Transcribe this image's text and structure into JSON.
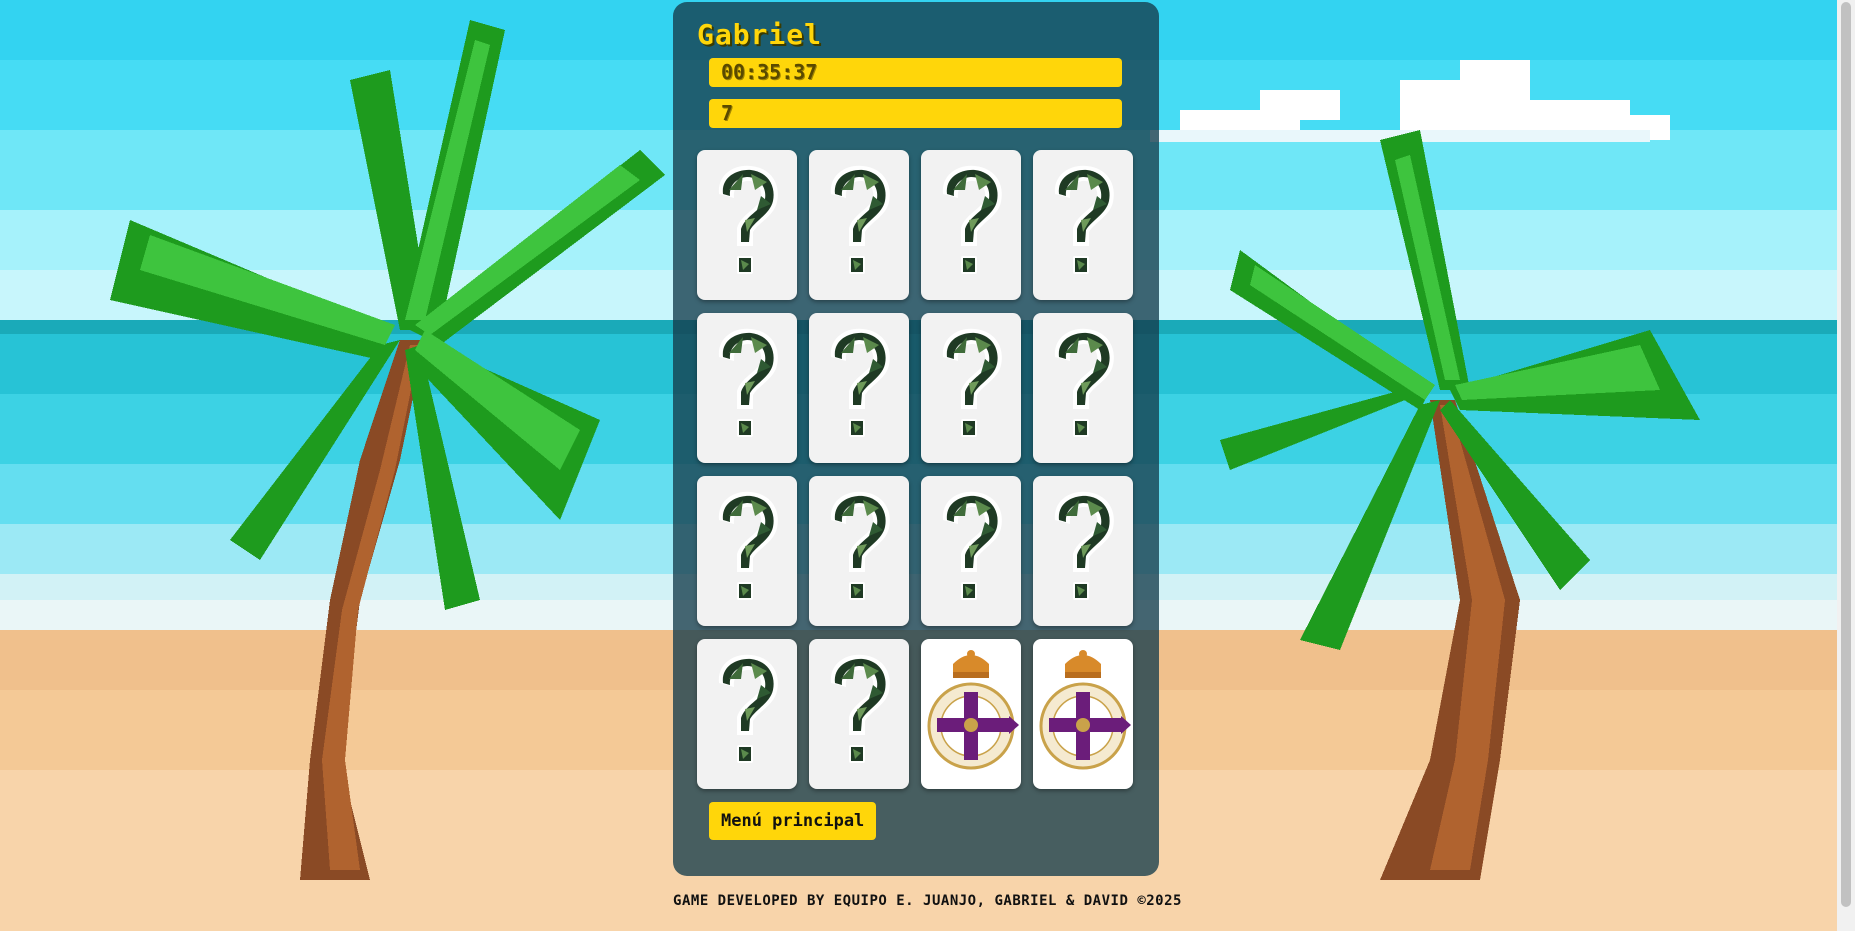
{
  "player": {
    "name": "Gabriel"
  },
  "stats": {
    "timer": "00:35:37",
    "moves": "7"
  },
  "board": {
    "cards": [
      {
        "state": "hidden",
        "icon": "question-mark-leaf-icon"
      },
      {
        "state": "hidden",
        "icon": "question-mark-leaf-icon"
      },
      {
        "state": "hidden",
        "icon": "question-mark-leaf-icon"
      },
      {
        "state": "hidden",
        "icon": "question-mark-leaf-icon"
      },
      {
        "state": "hidden",
        "icon": "question-mark-leaf-icon"
      },
      {
        "state": "hidden",
        "icon": "question-mark-leaf-icon"
      },
      {
        "state": "hidden",
        "icon": "question-mark-leaf-icon"
      },
      {
        "state": "hidden",
        "icon": "question-mark-leaf-icon"
      },
      {
        "state": "hidden",
        "icon": "question-mark-leaf-icon"
      },
      {
        "state": "hidden",
        "icon": "question-mark-leaf-icon"
      },
      {
        "state": "hidden",
        "icon": "question-mark-leaf-icon"
      },
      {
        "state": "hidden",
        "icon": "question-mark-leaf-icon"
      },
      {
        "state": "hidden",
        "icon": "question-mark-leaf-icon"
      },
      {
        "state": "hidden",
        "icon": "question-mark-leaf-icon"
      },
      {
        "state": "revealed",
        "icon": "deportivo-crest-icon"
      },
      {
        "state": "revealed",
        "icon": "deportivo-crest-icon"
      }
    ]
  },
  "menu": {
    "main_menu_label": "Menú principal"
  },
  "footer": {
    "credits": "GAME DEVELOPED BY EQUIPO E. JUANJO, GABRIEL & DAVID ©2025"
  },
  "colors": {
    "accent": "#ffd60a",
    "panel": "#1e4b57",
    "card": "#f2f2f2",
    "crest_purple": "#6b1d7a",
    "crest_gold": "#c9a24a"
  }
}
